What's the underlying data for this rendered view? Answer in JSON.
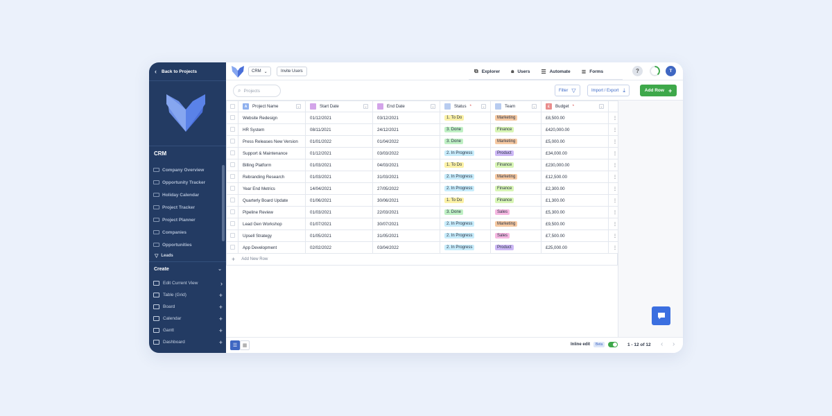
{
  "sidebar": {
    "back_label": "Back to Projects",
    "section_title": "CRM",
    "nav_items": [
      {
        "label": "Company Overview"
      },
      {
        "label": "Opportunity Tracker"
      },
      {
        "label": "Holiday Calendar"
      },
      {
        "label": "Project Tracker"
      },
      {
        "label": "Project Planner"
      },
      {
        "label": "Companies"
      },
      {
        "label": "Opportunities"
      }
    ],
    "sub_item": "Leads",
    "create_label": "Create",
    "create_items": [
      {
        "label": "Edit Current View",
        "action": "›"
      },
      {
        "label": "Table (Grid)",
        "action": "+"
      },
      {
        "label": "Board",
        "action": "+"
      },
      {
        "label": "Calendar",
        "action": "+"
      },
      {
        "label": "Gantt",
        "action": "+"
      },
      {
        "label": "Dashboard",
        "action": "+"
      }
    ]
  },
  "topbar": {
    "workspace": "CRM",
    "invite_label": "Invite Users",
    "tabs": [
      {
        "label": "Explorer",
        "icon": "explorer-icon"
      },
      {
        "label": "Users",
        "icon": "lock-icon"
      },
      {
        "label": "Automate",
        "icon": "automate-icon"
      },
      {
        "label": "Forms",
        "icon": "forms-icon"
      }
    ],
    "help": "?",
    "avatar_initial": "T"
  },
  "toolbar": {
    "search_placeholder": "Projects",
    "filter_label": "Filter",
    "import_label": "Import / Export",
    "add_row_label": "Add Row"
  },
  "table": {
    "columns": [
      {
        "label": "Project Name",
        "icon": "A",
        "color": "#8fb0ee",
        "required": ""
      },
      {
        "label": "Start Date",
        "icon": "",
        "color": "#d3a4e9",
        "required": ""
      },
      {
        "label": "End Date",
        "icon": "",
        "color": "#d3a4e9",
        "required": ""
      },
      {
        "label": "Status",
        "icon": "",
        "color": "#b8ccf0",
        "required": "*"
      },
      {
        "label": "Team",
        "icon": "",
        "color": "#b8ccf0",
        "required": ""
      },
      {
        "label": "Budget",
        "icon": "£",
        "color": "#e98c8c",
        "required": "*"
      }
    ],
    "rows": [
      {
        "name": "Website Redesign",
        "start": "01/12/2021",
        "end": "03/12/2021",
        "status": "1. To Do",
        "team": "Marketing",
        "budget": "£8,500.00"
      },
      {
        "name": "HR System",
        "start": "08/11/2021",
        "end": "24/12/2021",
        "status": "3. Done",
        "team": "Finance",
        "budget": "£420,000.00"
      },
      {
        "name": "Press Releases New Version",
        "start": "01/01/2022",
        "end": "01/04/2022",
        "status": "3. Done",
        "team": "Marketing",
        "budget": "£5,000.00"
      },
      {
        "name": "Support & Maintenance",
        "start": "01/12/2021",
        "end": "03/03/2022",
        "status": "2. In Progress",
        "team": "Product",
        "budget": "£34,000.00"
      },
      {
        "name": "Billing Platform",
        "start": "01/03/2021",
        "end": "04/03/2021",
        "status": "1. To Do",
        "team": "Finance",
        "budget": "£230,000.00"
      },
      {
        "name": "Rebranding Research",
        "start": "01/03/2021",
        "end": "31/03/2021",
        "status": "2. In Progress",
        "team": "Marketing",
        "budget": "£12,500.00"
      },
      {
        "name": "Year End Metrics",
        "start": "14/04/2021",
        "end": "27/05/2022",
        "status": "2. In Progress",
        "team": "Finance",
        "budget": "£2,300.00"
      },
      {
        "name": "Quarterly Board Update",
        "start": "01/06/2021",
        "end": "30/06/2021",
        "status": "1. To Do",
        "team": "Finance",
        "budget": "£1,300.00"
      },
      {
        "name": "Pipeline Review",
        "start": "01/03/2021",
        "end": "22/03/2021",
        "status": "3. Done",
        "team": "Sales",
        "budget": "£5,300.00"
      },
      {
        "name": "Lead Gen Workshop",
        "start": "01/07/2021",
        "end": "30/07/2021",
        "status": "2. In Progress",
        "team": "Marketing",
        "budget": "£9,500.00"
      },
      {
        "name": "Upsell Strategy",
        "start": "01/05/2021",
        "end": "31/05/2021",
        "status": "2. In Progress",
        "team": "Sales",
        "budget": "£7,500.00"
      },
      {
        "name": "App Development",
        "start": "02/02/2022",
        "end": "03/04/2022",
        "status": "2. In Progress",
        "team": "Product",
        "budget": "£25,000.00"
      }
    ],
    "add_new_row": "Add New Row",
    "status_colors": {
      "1. To Do": "#fbf1a6",
      "2. In Progress": "#c7ecfb",
      "3. Done": "#bff0c4"
    },
    "team_colors": {
      "Marketing": "#f6c9a2",
      "Finance": "#d8f5b5",
      "Product": "#cdb8f6",
      "Sales": "#f6b8e2"
    }
  },
  "footer": {
    "inline_edit_label": "Inline edit",
    "beta_label": "Beta",
    "inline_edit_on": true,
    "pagination": "1 - 12 of 12"
  }
}
